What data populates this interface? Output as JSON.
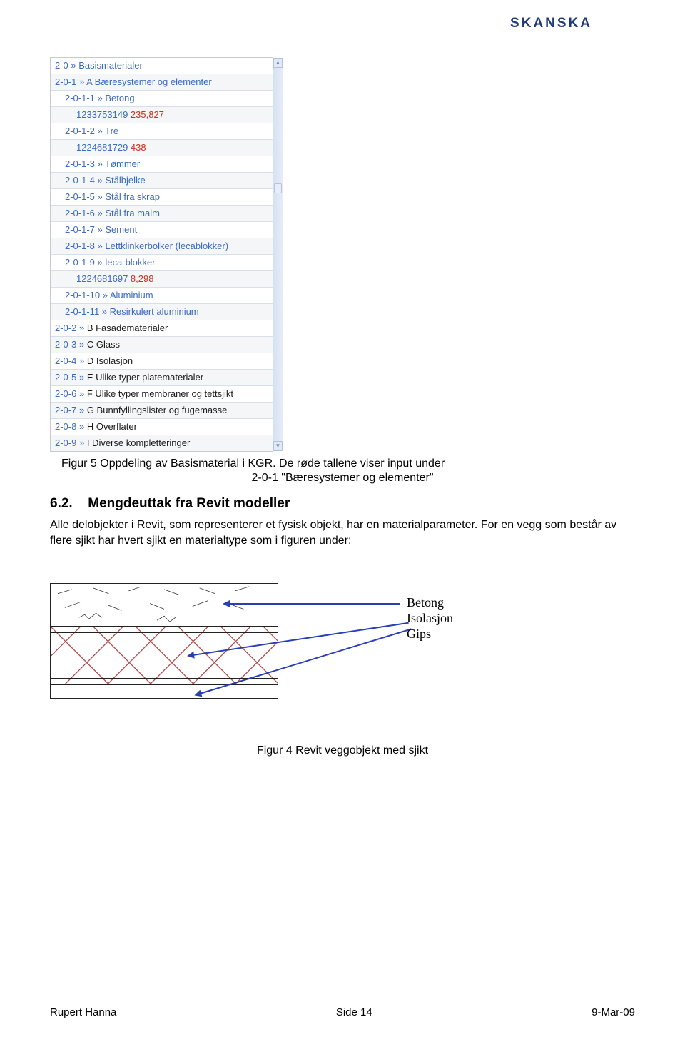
{
  "brand": "SKANSKA",
  "tree": [
    {
      "code": "2-0",
      "label": "Basismaterialer",
      "alt": false,
      "indent": 0,
      "type": "nav"
    },
    {
      "code": "2-0-1",
      "label": "A Bæresystemer og elementer",
      "alt": true,
      "indent": 0,
      "type": "nav"
    },
    {
      "code": "2-0-1-1",
      "label": "Betong",
      "alt": false,
      "indent": 1,
      "type": "nav"
    },
    {
      "num1": "1233753149",
      "num2": "235,827",
      "alt": true,
      "indent": 2,
      "type": "data"
    },
    {
      "code": "2-0-1-2",
      "label": "Tre",
      "alt": false,
      "indent": 1,
      "type": "nav"
    },
    {
      "num1": "1224681729",
      "num2": "438",
      "alt": true,
      "indent": 2,
      "type": "data"
    },
    {
      "code": "2-0-1-3",
      "label": "Tømmer",
      "alt": false,
      "indent": 1,
      "type": "nav"
    },
    {
      "code": "2-0-1-4",
      "label": "Stålbjelke",
      "alt": true,
      "indent": 1,
      "type": "nav"
    },
    {
      "code": "2-0-1-5",
      "label": "Stål fra skrap",
      "alt": false,
      "indent": 1,
      "type": "nav"
    },
    {
      "code": "2-0-1-6",
      "label": "Stål fra malm",
      "alt": true,
      "indent": 1,
      "type": "nav"
    },
    {
      "code": "2-0-1-7",
      "label": "Sement",
      "alt": false,
      "indent": 1,
      "type": "nav"
    },
    {
      "code": "2-0-1-8",
      "label": "Lettklinkerbolker (lecablokker)",
      "alt": true,
      "indent": 1,
      "type": "nav"
    },
    {
      "code": "2-0-1-9",
      "label": "leca-blokker",
      "alt": false,
      "indent": 1,
      "type": "nav"
    },
    {
      "num1": "1224681697",
      "num2": "8,298",
      "alt": true,
      "indent": 2,
      "type": "data"
    },
    {
      "code": "2-0-1-10",
      "label": "Aluminium",
      "alt": false,
      "indent": 1,
      "type": "nav"
    },
    {
      "code": "2-0-1-11",
      "label": "Resirkulert aluminium",
      "alt": true,
      "indent": 1,
      "type": "nav"
    },
    {
      "code": "2-0-2",
      "label": "B Fasadematerialer",
      "alt": false,
      "indent": 0,
      "type": "plain"
    },
    {
      "code": "2-0-3",
      "label": "C Glass",
      "alt": true,
      "indent": 0,
      "type": "plain"
    },
    {
      "code": "2-0-4",
      "label": "D Isolasjon",
      "alt": false,
      "indent": 0,
      "type": "plain"
    },
    {
      "code": "2-0-5",
      "label": "E Ulike typer platematerialer",
      "alt": true,
      "indent": 0,
      "type": "plain"
    },
    {
      "code": "2-0-6",
      "label": "F Ulike typer membraner og tettsjikt",
      "alt": false,
      "indent": 0,
      "type": "plain"
    },
    {
      "code": "2-0-7",
      "label": "G Bunnfyllingslister og fugemasse",
      "alt": true,
      "indent": 0,
      "type": "plain"
    },
    {
      "code": "2-0-8",
      "label": "H Overflater",
      "alt": false,
      "indent": 0,
      "type": "plain"
    },
    {
      "code": "2-0-9",
      "label": "I Diverse kompletteringer",
      "alt": true,
      "indent": 0,
      "type": "plain"
    }
  ],
  "fig5_caption_line1": "Figur 5 Oppdeling av Basismaterial i KGR. De røde tallene viser input under",
  "fig5_caption_line2": "2-0-1 \"Bæresystemer og elementer\"",
  "heading_num": "6.2.",
  "heading_text": "Mengdeuttak fra Revit modeller",
  "body_text": "Alle delobjekter i Revit, som representerer et fysisk objekt, har en materialparameter. For en vegg som består av flere sjikt har hvert sjikt en materialtype som i figuren under:",
  "legend": {
    "a": "Betong",
    "b": "Isolasjon",
    "c": "Gips"
  },
  "fig4_caption": "Figur 4 Revit veggobjekt med sjikt",
  "footer": {
    "left": "Rupert Hanna",
    "mid": "Side 14",
    "right": "9-Mar-09"
  }
}
